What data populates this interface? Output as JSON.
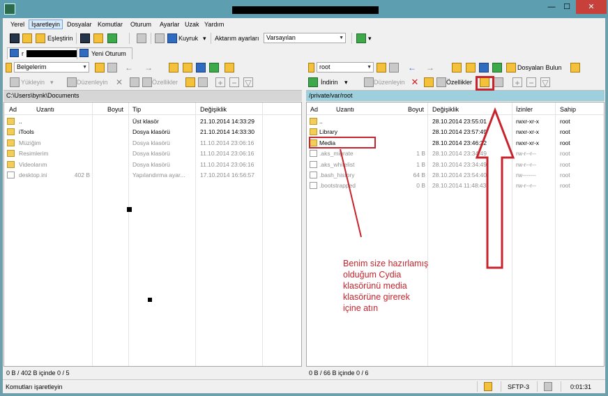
{
  "menu": [
    "Yerel",
    "İşaretleyin",
    "Dosyalar",
    "Komutlar",
    "Oturum",
    "Ayarlar",
    "Uzak",
    "Yardım"
  ],
  "toolbar": {
    "sync_label": "Eşleştirin",
    "queue_label": "Kuyruk",
    "transfer_label": "Aktarım ayarları",
    "transfer_value": "Varsayılan"
  },
  "tabs": {
    "new_session": "Yeni Oturum",
    "session_prefix": "r"
  },
  "left": {
    "location": "Belgelerim",
    "upload": "Yükleyin",
    "edit": "Düzenleyin",
    "properties": "Özellikler",
    "path": "C:\\Users\\bynk\\Documents",
    "columns": {
      "name": "Ad",
      "ext": "Uzantı",
      "size": "Boyut",
      "type": "Tip",
      "modified": "Değişiklik"
    },
    "files": [
      {
        "name": "..",
        "size": "",
        "type": "Üst klasör",
        "modified": "21.10.2014  14:33:29",
        "kind": "folder",
        "dim": false
      },
      {
        "name": "iTools",
        "size": "",
        "type": "Dosya klasörü",
        "modified": "21.10.2014  14:33:30",
        "kind": "folder",
        "dim": false
      },
      {
        "name": "Müziğim",
        "size": "",
        "type": "Dosya klasörü",
        "modified": "11.10.2014  23:06:16",
        "kind": "folder",
        "dim": true
      },
      {
        "name": "Resimlerim",
        "size": "",
        "type": "Dosya klasörü",
        "modified": "11.10.2014  23:06:16",
        "kind": "folder",
        "dim": true
      },
      {
        "name": "Videolarım",
        "size": "",
        "type": "Dosya klasörü",
        "modified": "11.10.2014  23:06:16",
        "kind": "folder",
        "dim": true
      },
      {
        "name": "desktop.ini",
        "size": "402 B",
        "type": "Yapılandırma ayar...",
        "modified": "17.10.2014  16:56:57",
        "kind": "file",
        "dim": true
      }
    ],
    "status": "0 B / 402 B içinde 0 / 5"
  },
  "right": {
    "location": "root",
    "find": "Dosyaları Bulun",
    "download": "İndirin",
    "edit": "Düzenleyin",
    "properties": "Özellikler",
    "path": "/private/var/root",
    "columns": {
      "name": "Ad",
      "ext": "Uzantı",
      "size": "Boyut",
      "modified": "Değişiklik",
      "perms": "İzinler",
      "owner": "Sahip"
    },
    "files": [
      {
        "name": "..",
        "size": "",
        "modified": "28.10.2014 23:55:01",
        "perms": "rwxr-xr-x",
        "owner": "root",
        "kind": "folder",
        "dim": false
      },
      {
        "name": "Library",
        "size": "",
        "modified": "28.10.2014 23:57:49",
        "perms": "rwxr-xr-x",
        "owner": "root",
        "kind": "folder",
        "dim": false
      },
      {
        "name": "Media",
        "size": "",
        "modified": "28.10.2014 23:46:22",
        "perms": "rwxr-xr-x",
        "owner": "root",
        "kind": "folder",
        "dim": false
      },
      {
        "name": ".aks_migrate",
        "size": "1 B",
        "modified": "28.10.2014 23:34:49",
        "perms": "rw-r--r--",
        "owner": "root",
        "kind": "file",
        "dim": true
      },
      {
        "name": ".aks_whitelist",
        "size": "1 B",
        "modified": "28.10.2014 23:34:49",
        "perms": "rw-r--r--",
        "owner": "root",
        "kind": "file",
        "dim": true
      },
      {
        "name": ".bash_history",
        "size": "64 B",
        "modified": "28.10.2014 23:54:40",
        "perms": "rw-------",
        "owner": "root",
        "kind": "file",
        "dim": true
      },
      {
        "name": ".bootstrapped",
        "size": "0 B",
        "modified": "28.10.2014 11:48:43",
        "perms": "rw-r--r--",
        "owner": "root",
        "kind": "file",
        "dim": true
      }
    ],
    "status": "0 B / 66 B içinde 0 / 6"
  },
  "statusbar": {
    "left": "Komutları işaretleyin",
    "protocol": "SFTP-3",
    "time": "0:01:31"
  },
  "annotation": {
    "lines": [
      "Benim size hazırlamış",
      "olduğum Cydia",
      "klasörünü media",
      "klasörüne girerek",
      "içine atın"
    ],
    "color": "#c8232c"
  }
}
